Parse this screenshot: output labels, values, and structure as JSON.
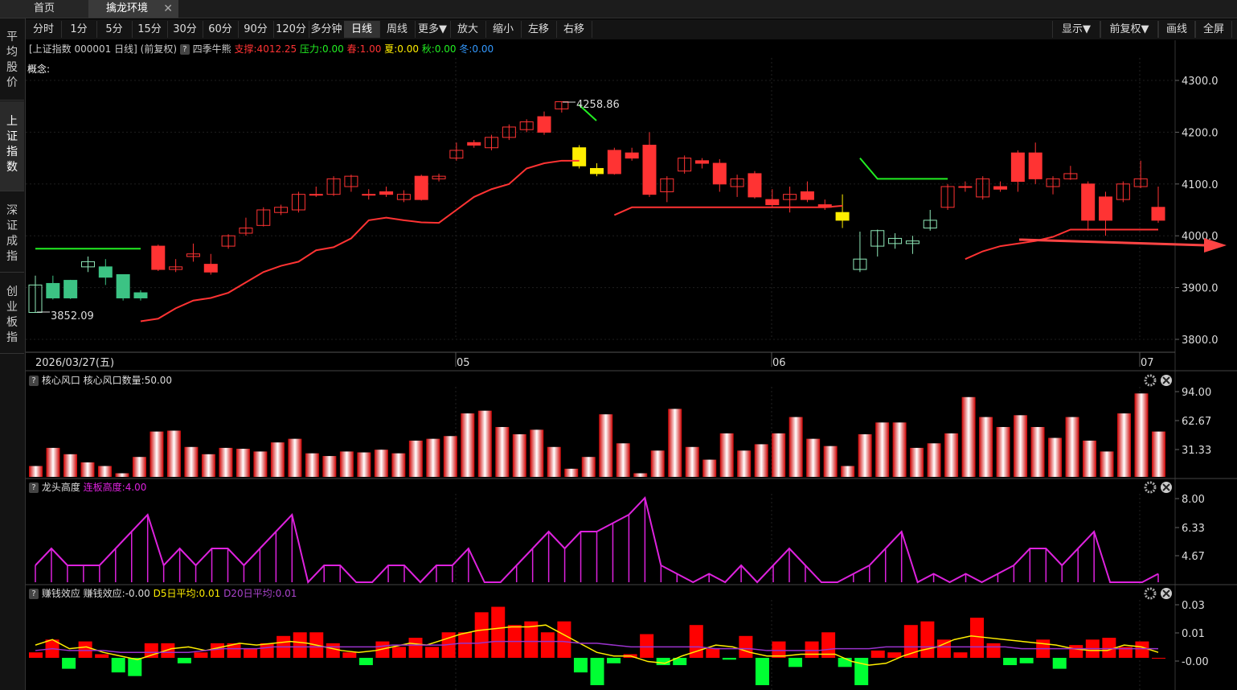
{
  "tabs": [
    {
      "label": "首页"
    },
    {
      "label": "擒龙环境"
    }
  ],
  "sidebar": {
    "items": [
      {
        "label": "平均股价"
      },
      {
        "label": "上证指数"
      },
      {
        "label": "深证成指"
      },
      {
        "label": "创业板指"
      }
    ]
  },
  "toolbar": {
    "periods": [
      "分时",
      "1分",
      "5分",
      "15分",
      "30分",
      "60分",
      "90分",
      "120分",
      "多分钟",
      "日线",
      "周线",
      "更多▼",
      "放大",
      "缩小",
      "左移",
      "右移"
    ],
    "active": "日线",
    "right": [
      "显示▼",
      "前复权▼",
      "画线",
      "全屏"
    ]
  },
  "info": {
    "symbol": "[上证指数 000001 日线]",
    "adjust": "(前复权)",
    "q": "?",
    "indicator": "四季牛熊",
    "support": "支撑:4012.25",
    "pressure": "压力:0.00",
    "spring": "春:1.00",
    "summer": "夏:0.00",
    "autumn": "秋:0.00",
    "winter": "冬:0.00"
  },
  "concept_label": "概念:",
  "price_axis": [
    "4300.0",
    "4200.0",
    "4100.0",
    "4000.0",
    "3900.0",
    "3800.0"
  ],
  "date_axis": {
    "current": "2026/03/27(五)",
    "months": [
      "05",
      "06",
      "07"
    ]
  },
  "annotations": {
    "high": "4258.86",
    "low": "3852.09"
  },
  "panel1": {
    "title": "核心风口",
    "value_label": "核心风口数量:50.00",
    "axis": [
      "94.00",
      "62.67",
      "31.33"
    ]
  },
  "panel2": {
    "title": "龙头高度",
    "value_label": "连板高度:4.00",
    "axis": [
      "8.00",
      "6.33",
      "4.67"
    ]
  },
  "panel3": {
    "title": "赚钱效应",
    "value_label": "赚钱效应:-0.00",
    "d5": "D5日平均:0.01",
    "d20": "D20日平均:0.01",
    "axis": [
      "0.03",
      "0.01",
      "-0.00"
    ]
  },
  "colors": {
    "up": "#ff3333",
    "down": "#3cc384",
    "yellow": "#ffee00",
    "green": "#22ee22",
    "magenta": "#dd22dd",
    "purple": "#9933cc"
  },
  "chart_data": {
    "type": "candlestick",
    "ylim": [
      3800,
      4320
    ],
    "candles": [
      [
        3905,
        3852,
        3923,
        3852,
        "h"
      ],
      [
        3908,
        3880,
        3923,
        3877,
        "d"
      ],
      [
        3880,
        3914,
        3915,
        3878,
        "d"
      ],
      [
        3950,
        3940,
        3960,
        3930,
        "h"
      ],
      [
        3940,
        3920,
        3955,
        3905,
        "d"
      ],
      [
        3880,
        3925,
        3925,
        3875,
        "d"
      ],
      [
        3890,
        3880,
        3895,
        3875,
        "d"
      ],
      [
        3935,
        3980,
        3983,
        3932,
        "u"
      ],
      [
        3935,
        3940,
        3955,
        3930,
        "u"
      ],
      [
        3960,
        3965,
        3985,
        3950,
        "u"
      ],
      [
        3945,
        3930,
        3965,
        3925,
        "u"
      ],
      [
        3980,
        4000,
        4003,
        3975,
        "u"
      ],
      [
        4005,
        4015,
        4035,
        4000,
        "u"
      ],
      [
        4020,
        4050,
        4055,
        4018,
        "u"
      ],
      [
        4045,
        4055,
        4060,
        4040,
        "u"
      ],
      [
        4050,
        4080,
        4085,
        4045,
        "u"
      ],
      [
        4080,
        4080,
        4095,
        4075,
        "u"
      ],
      [
        4080,
        4110,
        4115,
        4077,
        "u"
      ],
      [
        4095,
        4115,
        4118,
        4085,
        "u"
      ],
      [
        4080,
        4080,
        4090,
        4070,
        "u"
      ],
      [
        4085,
        4080,
        4095,
        4075,
        "u"
      ],
      [
        4070,
        4080,
        4088,
        4065,
        "u"
      ],
      [
        4070,
        4115,
        4118,
        4068,
        "u"
      ],
      [
        4110,
        4115,
        4120,
        4105,
        "u"
      ],
      [
        4150,
        4165,
        4180,
        4145,
        "u"
      ],
      [
        4180,
        4175,
        4185,
        4170,
        "u"
      ],
      [
        4170,
        4190,
        4195,
        4165,
        "u"
      ],
      [
        4190,
        4210,
        4215,
        4185,
        "u"
      ],
      [
        4205,
        4220,
        4225,
        4200,
        "u"
      ],
      [
        4230,
        4200,
        4240,
        4195,
        "u"
      ],
      [
        4245,
        4258.86,
        4258.86,
        4238,
        "u"
      ],
      [
        4170,
        4135,
        4175,
        4130,
        "y"
      ],
      [
        4130,
        4120,
        4140,
        4115,
        "y"
      ],
      [
        4120,
        4165,
        4170,
        4118,
        "u"
      ],
      [
        4160,
        4150,
        4170,
        4145,
        "u"
      ],
      [
        4175,
        4080,
        4200,
        4075,
        "u"
      ],
      [
        4085,
        4110,
        4115,
        4065,
        "u"
      ],
      [
        4125,
        4150,
        4155,
        4120,
        "u"
      ],
      [
        4145,
        4140,
        4150,
        4130,
        "u"
      ],
      [
        4140,
        4100,
        4148,
        4085,
        "u"
      ],
      [
        4095,
        4110,
        4118,
        4075,
        "u"
      ],
      [
        4075,
        4120,
        4125,
        4072,
        "u"
      ],
      [
        4070,
        4060,
        4090,
        4055,
        "u"
      ],
      [
        4070,
        4080,
        4095,
        4045,
        "u"
      ],
      [
        4085,
        4070,
        4105,
        4065,
        "u"
      ],
      [
        4060,
        4055,
        4070,
        4050,
        "u"
      ],
      [
        4045,
        4030,
        4080,
        4015,
        "y"
      ],
      [
        3935,
        3955,
        4008,
        3930,
        "h"
      ],
      [
        3980,
        4010,
        4012,
        3960,
        "h"
      ],
      [
        3995,
        3985,
        4005,
        3975,
        "h"
      ],
      [
        3985,
        3990,
        4000,
        3965,
        "h"
      ],
      [
        4015,
        4030,
        4050,
        4010,
        "h"
      ],
      [
        4055,
        4095,
        4100,
        4050,
        "u"
      ],
      [
        4095,
        4095,
        4105,
        4085,
        "u"
      ],
      [
        4075,
        4110,
        4115,
        4070,
        "u"
      ],
      [
        4095,
        4090,
        4105,
        4085,
        "u"
      ],
      [
        4105,
        4160,
        4165,
        4085,
        "u"
      ],
      [
        4160,
        4110,
        4180,
        4100,
        "u"
      ],
      [
        4095,
        4110,
        4115,
        4080,
        "u"
      ],
      [
        4110,
        4120,
        4135,
        4108,
        "u"
      ],
      [
        4100,
        4030,
        4105,
        4010,
        "u"
      ],
      [
        4030,
        4075,
        4085,
        4000,
        "u"
      ],
      [
        4070,
        4100,
        4105,
        4065,
        "u"
      ],
      [
        4095,
        4110,
        4145,
        4092,
        "u"
      ],
      [
        4055,
        4030,
        4095,
        4025,
        "u"
      ]
    ],
    "support_line": [
      [
        6,
        3835
      ],
      [
        7,
        3840
      ],
      [
        8,
        3860
      ],
      [
        9,
        3875
      ],
      [
        10,
        3880
      ],
      [
        11,
        3890
      ],
      [
        12,
        3910
      ],
      [
        13,
        3930
      ],
      [
        14,
        3942
      ],
      [
        15,
        3950
      ],
      [
        16,
        3972
      ],
      [
        17,
        3978
      ],
      [
        18,
        3995
      ],
      [
        19,
        4030
      ],
      [
        20,
        4035
      ],
      [
        21,
        4030
      ],
      [
        22,
        4026
      ],
      [
        23,
        4025
      ],
      [
        24,
        4050
      ],
      [
        25,
        4075
      ],
      [
        26,
        4090
      ],
      [
        27,
        4100
      ],
      [
        28,
        4130
      ],
      [
        29,
        4140
      ],
      [
        30,
        4145
      ],
      [
        31,
        4145
      ],
      [
        33,
        4040
      ],
      [
        34,
        4055
      ],
      [
        35,
        4055
      ],
      [
        36,
        4055
      ],
      [
        37,
        4055
      ],
      [
        38,
        4055
      ],
      [
        39,
        4055
      ],
      [
        40,
        4055
      ],
      [
        41,
        4055
      ],
      [
        42,
        4055
      ],
      [
        43,
        4055
      ],
      [
        44,
        4055
      ],
      [
        45,
        4055
      ],
      [
        46,
        4058
      ],
      [
        53,
        3955
      ],
      [
        54,
        3970
      ],
      [
        55,
        3980
      ],
      [
        56,
        3985
      ],
      [
        57,
        3990
      ],
      [
        58,
        3998
      ],
      [
        59,
        4012
      ],
      [
        60,
        4012
      ],
      [
        61,
        4012
      ],
      [
        62,
        4012
      ],
      [
        63,
        4012
      ],
      [
        64,
        4012
      ]
    ],
    "green_lines": [
      [
        [
          0,
          3975
        ],
        [
          6,
          3975
        ]
      ],
      [
        [
          47,
          4150
        ],
        [
          48,
          4110
        ],
        [
          52,
          4110
        ]
      ]
    ],
    "panel1_values": [
      12,
      32,
      25,
      16,
      12,
      4,
      22,
      50,
      51,
      33,
      25,
      32,
      31,
      28,
      38,
      42,
      26,
      23,
      28,
      27,
      30,
      26,
      40,
      42,
      45,
      70,
      73,
      55,
      47,
      52,
      33,
      9,
      22,
      69,
      37,
      4,
      29,
      75,
      33,
      19,
      48,
      29,
      36,
      48,
      66,
      42,
      34,
      12,
      47,
      60,
      60,
      32,
      37,
      48,
      88,
      66,
      55,
      68,
      55,
      43,
      66,
      40,
      28,
      70,
      92,
      50
    ],
    "panel2_values": [
      4,
      5,
      4,
      4,
      4,
      5,
      6,
      7,
      4,
      5,
      4,
      5,
      5,
      4,
      5,
      6,
      7,
      3,
      4,
      4,
      3,
      3,
      4,
      4,
      3,
      4,
      4,
      5,
      3,
      3,
      4,
      5,
      6,
      5,
      6,
      6,
      6.5,
      7,
      8,
      4,
      3.5,
      3,
      3.5,
      3,
      4,
      3,
      4,
      5,
      4,
      3,
      3,
      3.5,
      4,
      5,
      6,
      3,
      3.5,
      3,
      3.5,
      3,
      3.5,
      4,
      5,
      5,
      4,
      5,
      6,
      3,
      3,
      3,
      3.5
    ],
    "panel3_bars": [
      0.003,
      0.01,
      -0.006,
      0.009,
      0.002,
      -0.008,
      -0.01,
      0.008,
      0.008,
      -0.003,
      0.003,
      0.008,
      0.008,
      0.005,
      0.008,
      0.012,
      0.014,
      0.014,
      0.008,
      0.003,
      -0.004,
      0.009,
      0.006,
      0.011,
      0.006,
      0.014,
      0.014,
      0.025,
      0.028,
      0.018,
      0.02,
      0.014,
      0.02,
      -0.008,
      -0.015,
      -0.003,
      0.002,
      0.013,
      -0.004,
      -0.004,
      0.018,
      0.005,
      -0.001,
      0.012,
      -0.015,
      0.009,
      -0.005,
      0.009,
      0.014,
      -0.005,
      -0.015,
      0.004,
      0.003,
      0.018,
      0.02,
      0.01,
      0.003,
      0.022,
      0.008,
      -0.004,
      -0.003,
      0.01,
      -0.006,
      0.007,
      0.01,
      0.011,
      0.006,
      0.009,
      0
    ],
    "panel3_d5": [
      0.007,
      0.01,
      0.005,
      0.006,
      0.003,
      0.001,
      -0.001,
      0.002,
      0.005,
      0.006,
      0.004,
      0.006,
      0.008,
      0.007,
      0.008,
      0.009,
      0.008,
      0.006,
      0.004,
      0.003,
      0.004,
      0.006,
      0.008,
      0.007,
      0.01,
      0.013,
      0.015,
      0.016,
      0.017,
      0.017,
      0.018,
      0.013,
      0.008,
      0.003,
      0.001,
      0.001,
      -0.002,
      -0.003,
      0.001,
      0.004,
      0.007,
      0.006,
      0.003,
      0.001,
      0.001,
      0.002,
      0.002,
      0.002,
      -0.002,
      -0.004,
      -0.003,
      0.001,
      0.004,
      0.006,
      0.01,
      0.012,
      0.011,
      0.01,
      0.009,
      0.008,
      0.007,
      0.005,
      0.004,
      0.004,
      0.007,
      0.006,
      0.003
    ],
    "panel3_d20": [
      0.004,
      0.005,
      0.004,
      0.004,
      0.004,
      0.003,
      0.003,
      0.003,
      0.003,
      0.003,
      0.004,
      0.005,
      0.005,
      0.005,
      0.006,
      0.006,
      0.006,
      0.006,
      0.006,
      0.006,
      0.006,
      0.007,
      0.007,
      0.007,
      0.007,
      0.008,
      0.008,
      0.009,
      0.009,
      0.009,
      0.009,
      0.009,
      0.008,
      0.008,
      0.007,
      0.006,
      0.006,
      0.006,
      0.006,
      0.006,
      0.005,
      0.005,
      0.005,
      0.004,
      0.004,
      0.004,
      0.004,
      0.005,
      0.005,
      0.005,
      0.006,
      0.006,
      0.006,
      0.006,
      0.006,
      0.006,
      0.006,
      0.006,
      0.005,
      0.005,
      0.005,
      0.005,
      0.005,
      0.005,
      0.005,
      0.005,
      0.005
    ]
  }
}
